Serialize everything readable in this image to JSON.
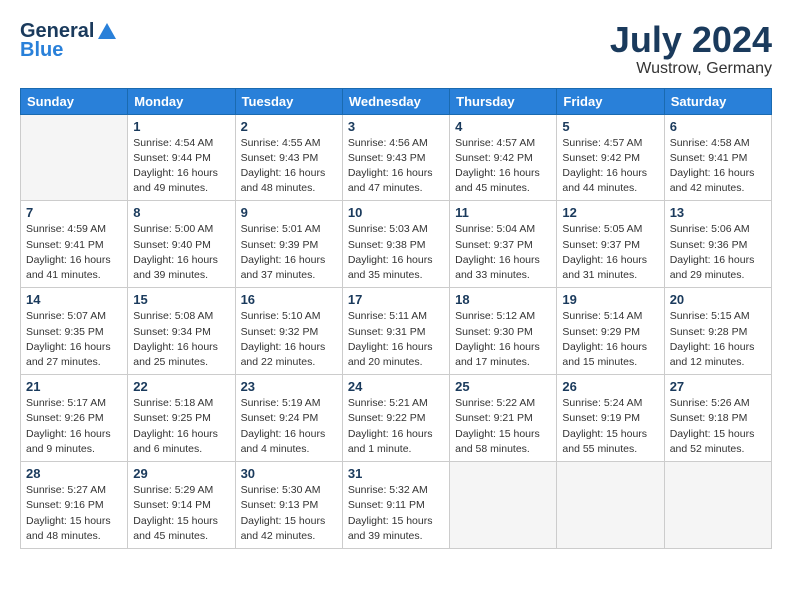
{
  "logo": {
    "general": "General",
    "blue": "Blue"
  },
  "title": {
    "month_year": "July 2024",
    "location": "Wustrow, Germany"
  },
  "days": [
    "Sunday",
    "Monday",
    "Tuesday",
    "Wednesday",
    "Thursday",
    "Friday",
    "Saturday"
  ],
  "weeks": [
    [
      {
        "date": "",
        "sunrise": "",
        "sunset": "",
        "daylight": ""
      },
      {
        "date": "1",
        "sunrise": "Sunrise: 4:54 AM",
        "sunset": "Sunset: 9:44 PM",
        "daylight": "Daylight: 16 hours and 49 minutes."
      },
      {
        "date": "2",
        "sunrise": "Sunrise: 4:55 AM",
        "sunset": "Sunset: 9:43 PM",
        "daylight": "Daylight: 16 hours and 48 minutes."
      },
      {
        "date": "3",
        "sunrise": "Sunrise: 4:56 AM",
        "sunset": "Sunset: 9:43 PM",
        "daylight": "Daylight: 16 hours and 47 minutes."
      },
      {
        "date": "4",
        "sunrise": "Sunrise: 4:57 AM",
        "sunset": "Sunset: 9:42 PM",
        "daylight": "Daylight: 16 hours and 45 minutes."
      },
      {
        "date": "5",
        "sunrise": "Sunrise: 4:57 AM",
        "sunset": "Sunset: 9:42 PM",
        "daylight": "Daylight: 16 hours and 44 minutes."
      },
      {
        "date": "6",
        "sunrise": "Sunrise: 4:58 AM",
        "sunset": "Sunset: 9:41 PM",
        "daylight": "Daylight: 16 hours and 42 minutes."
      }
    ],
    [
      {
        "date": "7",
        "sunrise": "Sunrise: 4:59 AM",
        "sunset": "Sunset: 9:41 PM",
        "daylight": "Daylight: 16 hours and 41 minutes."
      },
      {
        "date": "8",
        "sunrise": "Sunrise: 5:00 AM",
        "sunset": "Sunset: 9:40 PM",
        "daylight": "Daylight: 16 hours and 39 minutes."
      },
      {
        "date": "9",
        "sunrise": "Sunrise: 5:01 AM",
        "sunset": "Sunset: 9:39 PM",
        "daylight": "Daylight: 16 hours and 37 minutes."
      },
      {
        "date": "10",
        "sunrise": "Sunrise: 5:03 AM",
        "sunset": "Sunset: 9:38 PM",
        "daylight": "Daylight: 16 hours and 35 minutes."
      },
      {
        "date": "11",
        "sunrise": "Sunrise: 5:04 AM",
        "sunset": "Sunset: 9:37 PM",
        "daylight": "Daylight: 16 hours and 33 minutes."
      },
      {
        "date": "12",
        "sunrise": "Sunrise: 5:05 AM",
        "sunset": "Sunset: 9:37 PM",
        "daylight": "Daylight: 16 hours and 31 minutes."
      },
      {
        "date": "13",
        "sunrise": "Sunrise: 5:06 AM",
        "sunset": "Sunset: 9:36 PM",
        "daylight": "Daylight: 16 hours and 29 minutes."
      }
    ],
    [
      {
        "date": "14",
        "sunrise": "Sunrise: 5:07 AM",
        "sunset": "Sunset: 9:35 PM",
        "daylight": "Daylight: 16 hours and 27 minutes."
      },
      {
        "date": "15",
        "sunrise": "Sunrise: 5:08 AM",
        "sunset": "Sunset: 9:34 PM",
        "daylight": "Daylight: 16 hours and 25 minutes."
      },
      {
        "date": "16",
        "sunrise": "Sunrise: 5:10 AM",
        "sunset": "Sunset: 9:32 PM",
        "daylight": "Daylight: 16 hours and 22 minutes."
      },
      {
        "date": "17",
        "sunrise": "Sunrise: 5:11 AM",
        "sunset": "Sunset: 9:31 PM",
        "daylight": "Daylight: 16 hours and 20 minutes."
      },
      {
        "date": "18",
        "sunrise": "Sunrise: 5:12 AM",
        "sunset": "Sunset: 9:30 PM",
        "daylight": "Daylight: 16 hours and 17 minutes."
      },
      {
        "date": "19",
        "sunrise": "Sunrise: 5:14 AM",
        "sunset": "Sunset: 9:29 PM",
        "daylight": "Daylight: 16 hours and 15 minutes."
      },
      {
        "date": "20",
        "sunrise": "Sunrise: 5:15 AM",
        "sunset": "Sunset: 9:28 PM",
        "daylight": "Daylight: 16 hours and 12 minutes."
      }
    ],
    [
      {
        "date": "21",
        "sunrise": "Sunrise: 5:17 AM",
        "sunset": "Sunset: 9:26 PM",
        "daylight": "Daylight: 16 hours and 9 minutes."
      },
      {
        "date": "22",
        "sunrise": "Sunrise: 5:18 AM",
        "sunset": "Sunset: 9:25 PM",
        "daylight": "Daylight: 16 hours and 6 minutes."
      },
      {
        "date": "23",
        "sunrise": "Sunrise: 5:19 AM",
        "sunset": "Sunset: 9:24 PM",
        "daylight": "Daylight: 16 hours and 4 minutes."
      },
      {
        "date": "24",
        "sunrise": "Sunrise: 5:21 AM",
        "sunset": "Sunset: 9:22 PM",
        "daylight": "Daylight: 16 hours and 1 minute."
      },
      {
        "date": "25",
        "sunrise": "Sunrise: 5:22 AM",
        "sunset": "Sunset: 9:21 PM",
        "daylight": "Daylight: 15 hours and 58 minutes."
      },
      {
        "date": "26",
        "sunrise": "Sunrise: 5:24 AM",
        "sunset": "Sunset: 9:19 PM",
        "daylight": "Daylight: 15 hours and 55 minutes."
      },
      {
        "date": "27",
        "sunrise": "Sunrise: 5:26 AM",
        "sunset": "Sunset: 9:18 PM",
        "daylight": "Daylight: 15 hours and 52 minutes."
      }
    ],
    [
      {
        "date": "28",
        "sunrise": "Sunrise: 5:27 AM",
        "sunset": "Sunset: 9:16 PM",
        "daylight": "Daylight: 15 hours and 48 minutes."
      },
      {
        "date": "29",
        "sunrise": "Sunrise: 5:29 AM",
        "sunset": "Sunset: 9:14 PM",
        "daylight": "Daylight: 15 hours and 45 minutes."
      },
      {
        "date": "30",
        "sunrise": "Sunrise: 5:30 AM",
        "sunset": "Sunset: 9:13 PM",
        "daylight": "Daylight: 15 hours and 42 minutes."
      },
      {
        "date": "31",
        "sunrise": "Sunrise: 5:32 AM",
        "sunset": "Sunset: 9:11 PM",
        "daylight": "Daylight: 15 hours and 39 minutes."
      },
      {
        "date": "",
        "sunrise": "",
        "sunset": "",
        "daylight": ""
      },
      {
        "date": "",
        "sunrise": "",
        "sunset": "",
        "daylight": ""
      },
      {
        "date": "",
        "sunrise": "",
        "sunset": "",
        "daylight": ""
      }
    ]
  ]
}
